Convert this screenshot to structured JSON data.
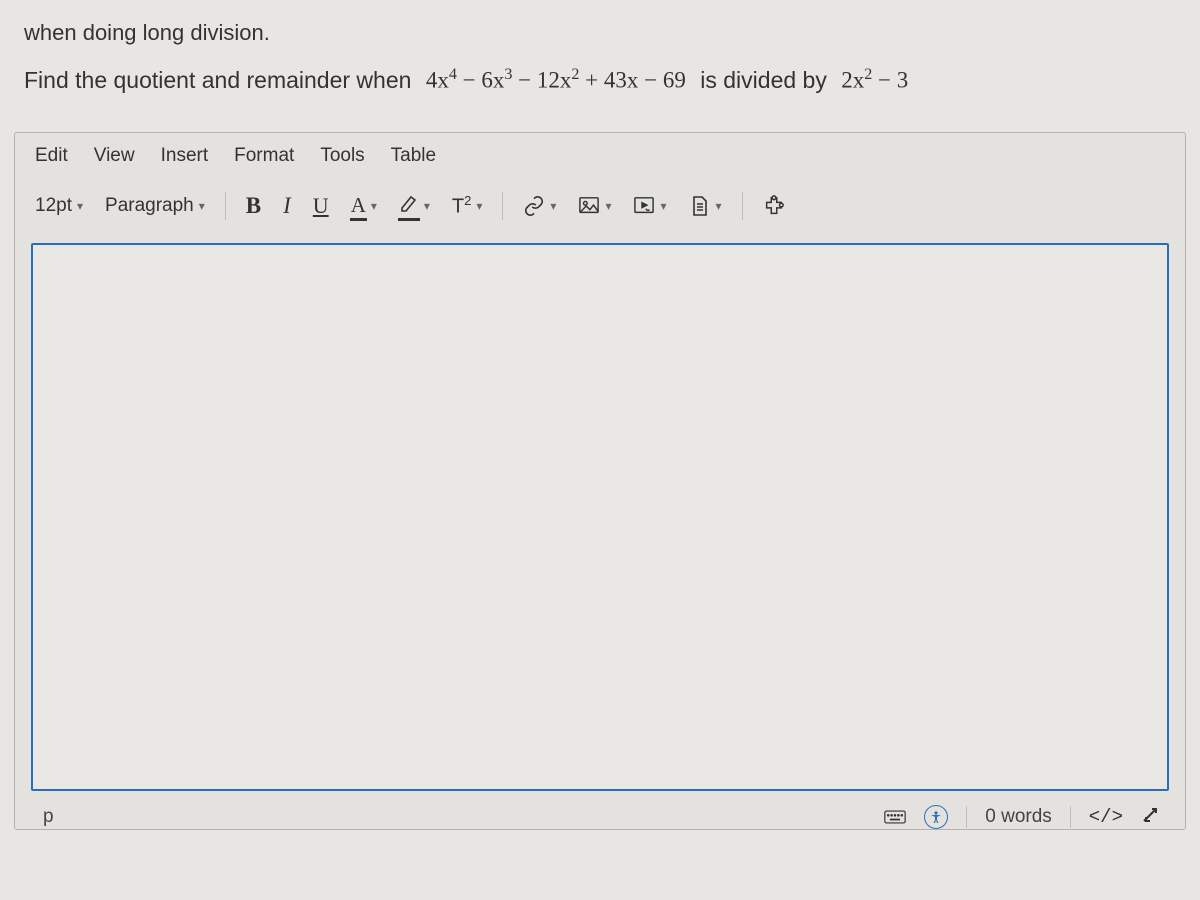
{
  "intro": "when doing long division.",
  "problem": {
    "lead": "Find the quotient and remainder when",
    "poly_parts": [
      "4x",
      "4",
      " − 6x",
      "3",
      " − 12x",
      "2",
      " + 43x − 69"
    ],
    "mid": "is divided by",
    "divisor_parts": [
      "2x",
      "2",
      " − 3"
    ]
  },
  "menubar": [
    "Edit",
    "View",
    "Insert",
    "Format",
    "Tools",
    "Table"
  ],
  "toolbar": {
    "font_size": "12pt",
    "block_format": "Paragraph",
    "bold": "B",
    "italic": "I",
    "underline": "U",
    "font_color_glyph": "A",
    "superscript_label": "T²"
  },
  "editor": {
    "content": ""
  },
  "statusbar": {
    "path": "p",
    "word_count": "0 words",
    "code_label": "</>"
  }
}
